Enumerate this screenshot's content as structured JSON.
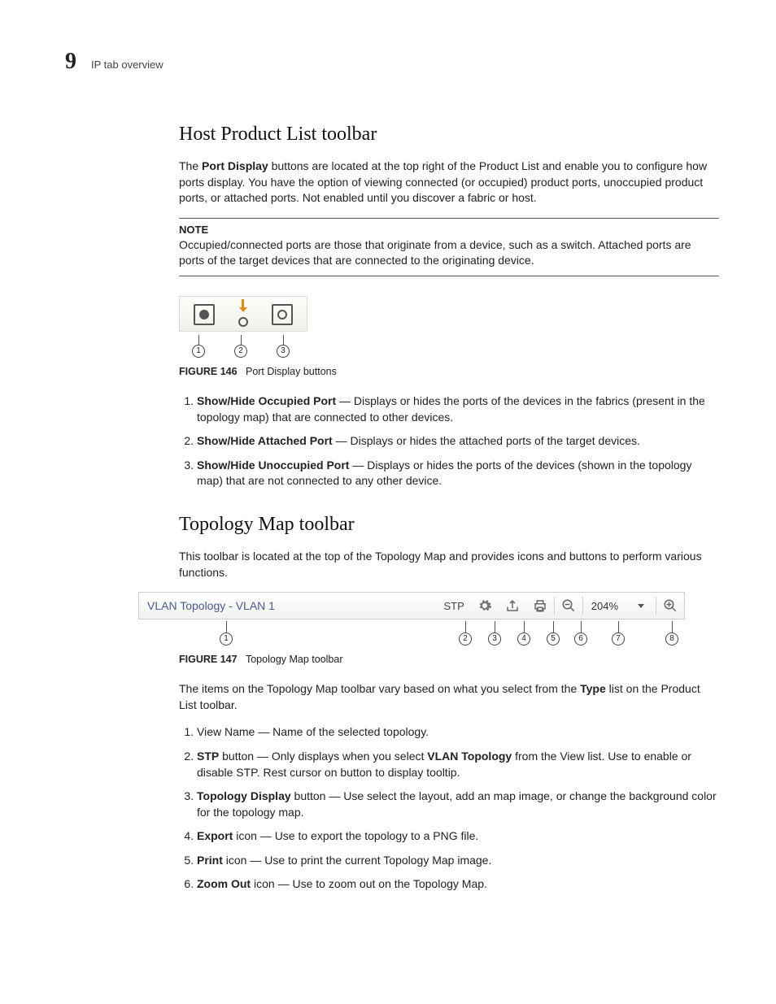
{
  "header": {
    "chapter": "9",
    "breadcrumb": "IP tab overview"
  },
  "section1": {
    "title": "Host Product List toolbar",
    "intro_pre": "The ",
    "intro_bold": "Port Display",
    "intro_post": " buttons are located at the top right of the Product List and enable you to configure how ports display. You have the option of viewing connected (or occupied) product ports, unoccupied product ports, or attached ports. Not enabled until you discover a fabric or host.",
    "note_label": "NOTE",
    "note_text": "Occupied/connected ports are those that originate from a device, such as a switch. Attached ports are ports of the target devices that are connected to the originating device.",
    "fig_caption_bold": "FIGURE 146",
    "fig_caption_text": "Port Display buttons",
    "items": [
      {
        "bold": "Show/Hide Occupied Port",
        "text": " — Displays or hides the ports of the devices in the fabrics (present in the topology map) that are connected to other devices."
      },
      {
        "bold": "Show/Hide Attached Port",
        "text": " — Displays or hides the attached ports of the target devices."
      },
      {
        "bold": "Show/Hide Unoccupied Port",
        "text": " — Displays or hides the ports of the devices (shown in the topology map) that are not connected to any other device."
      }
    ]
  },
  "section2": {
    "title": "Topology Map toolbar",
    "intro": "This toolbar is located at the top of the Topology Map and provides icons and buttons to perform various functions.",
    "toolbar": {
      "view_name": "VLAN Topology - VLAN 1",
      "stp_label": "STP",
      "zoom_text": "204%"
    },
    "fig_caption_bold": "FIGURE 147",
    "fig_caption_text": "Topology Map toolbar",
    "after_fig_pre": "The items on the Topology Map toolbar vary based on what you select from the ",
    "after_fig_bold": "Type",
    "after_fig_post": " list on the Product List toolbar.",
    "items": [
      {
        "pre": "View Name — Name of the selected topology.",
        "bold": "",
        "post": ""
      },
      {
        "pre": "",
        "bold": "STP",
        "post": " button — Only displays when you select ",
        "bold2": "VLAN Topology",
        "post2": " from the View list. Use to enable or disable STP. Rest cursor on button to display tooltip."
      },
      {
        "pre": "",
        "bold": "Topology Display",
        "post": " button — Use select the layout, add an map image, or change the background color for the topology map."
      },
      {
        "pre": "",
        "bold": "Export",
        "post": " icon — Use to export the topology to a PNG file."
      },
      {
        "pre": "",
        "bold": "Print",
        "post": " icon — Use to print the current Topology Map image."
      },
      {
        "pre": "",
        "bold": "Zoom Out",
        "post": " icon — Use to zoom out on the Topology Map."
      }
    ]
  },
  "callouts": {
    "c1": "1",
    "c2": "2",
    "c3": "3",
    "c4": "4",
    "c5": "5",
    "c6": "6",
    "c7": "7",
    "c8": "8"
  }
}
